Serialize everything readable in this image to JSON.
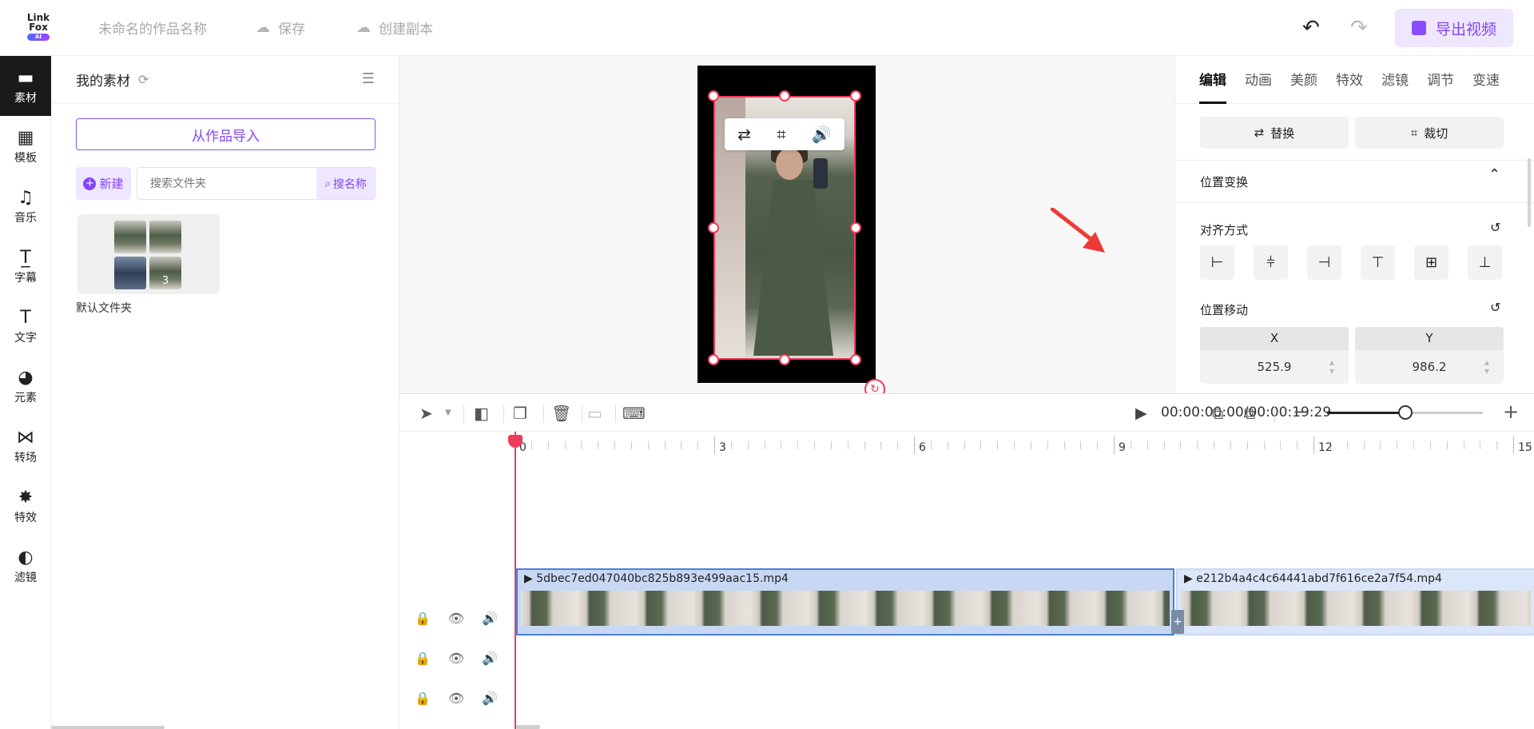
{
  "topbar": {
    "logo_line1": "Link",
    "logo_line2": "Fox",
    "logo_badge": "AI",
    "project_name": "未命名的作品名称",
    "save_label": "保存",
    "copy_label": "创建副本",
    "export_label": "导出视频",
    "accent": "#8246f5"
  },
  "leftnav": {
    "items": [
      {
        "label": "素材",
        "icon": "folder-icon"
      },
      {
        "label": "模板",
        "icon": "template-icon"
      },
      {
        "label": "音乐",
        "icon": "music-icon"
      },
      {
        "label": "字幕",
        "icon": "subtitle-icon"
      },
      {
        "label": "文字",
        "icon": "text-icon"
      },
      {
        "label": "元素",
        "icon": "element-icon"
      },
      {
        "label": "转场",
        "icon": "transition-icon"
      },
      {
        "label": "特效",
        "icon": "effect-icon"
      },
      {
        "label": "滤镜",
        "icon": "filter-icon"
      }
    ]
  },
  "panel": {
    "title": "我的素材",
    "import_label": "从作品导入",
    "new_label": "新建",
    "search_placeholder": "搜索文件夹",
    "search_btn": "搜名称",
    "folder_count": "3",
    "folder_name": "默认文件夹"
  },
  "props": {
    "tabs": [
      "编辑",
      "动画",
      "美颜",
      "特效",
      "滤镜",
      "调节",
      "变速"
    ],
    "replace_label": "替换",
    "crop_label": "裁切",
    "transform_title": "位置变换",
    "align_title": "对齐方式",
    "move_title": "位置移动",
    "x_label": "X",
    "y_label": "Y",
    "x_value": "525.9",
    "y_value": "986.2"
  },
  "timeline": {
    "timecode": "00:00:00:00/00:00:19:29",
    "ruler_labels": [
      "0",
      "3",
      "6",
      "9",
      "12",
      "15"
    ],
    "clip1_name": "5dbec7ed047040bc825b893e499aac15.mp4",
    "clip2_name": "e212b4a4c4c64441abd7f616ce2a7f54.mp4"
  }
}
